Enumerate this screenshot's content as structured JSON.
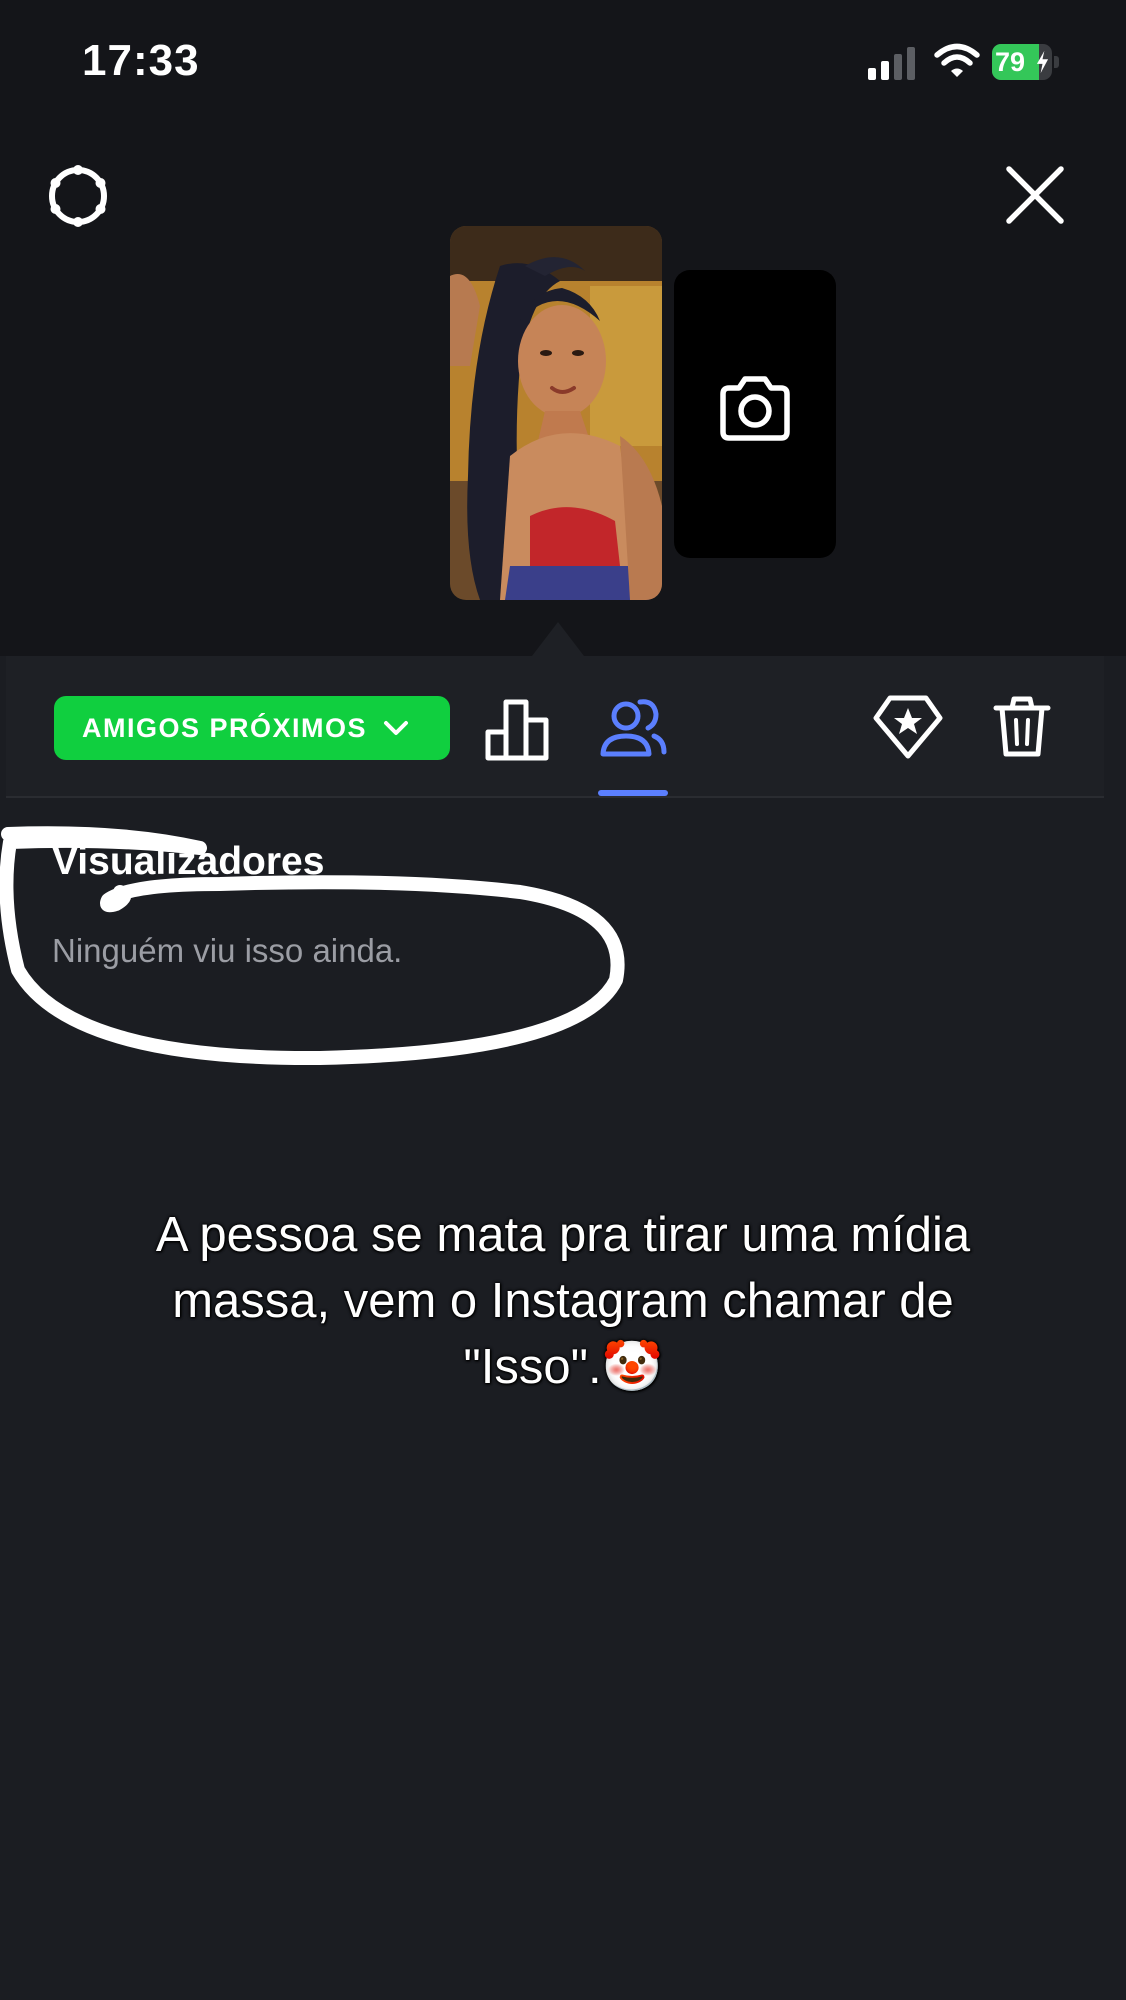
{
  "status_bar": {
    "time": "17:33",
    "battery_percent": "79",
    "battery_level": 0.79,
    "battery_color": "#34c759",
    "signal_icon": "cellular-signal-icon",
    "wifi_icon": "wifi-icon",
    "charging_icon": "bolt-icon"
  },
  "header": {
    "settings_icon": "gear-icon",
    "close_icon": "close-icon"
  },
  "story": {
    "thumbnail": "story-photo-thumbnail",
    "add_icon": "camera-icon"
  },
  "toolbar": {
    "audience_label": "AMIGOS PRÓXIMOS",
    "audience_color": "#10cf3f",
    "chevron_icon": "chevron-down-icon",
    "insights_icon": "bar-chart-icon",
    "viewers_icon": "people-icon",
    "highlight_icon": "diamond-star-icon",
    "delete_icon": "trash-icon",
    "active_tab": "viewers",
    "active_color": "#5b7ffe"
  },
  "viewers": {
    "title": "Visualizadores",
    "empty_message": "Ninguém viu isso ainda."
  },
  "overlay": {
    "caption": "A pessoa se mata pra tirar uma mídia massa, vem o Instagram chamar de \"Isso\".🤡",
    "scribble_color": "#ffffff"
  }
}
